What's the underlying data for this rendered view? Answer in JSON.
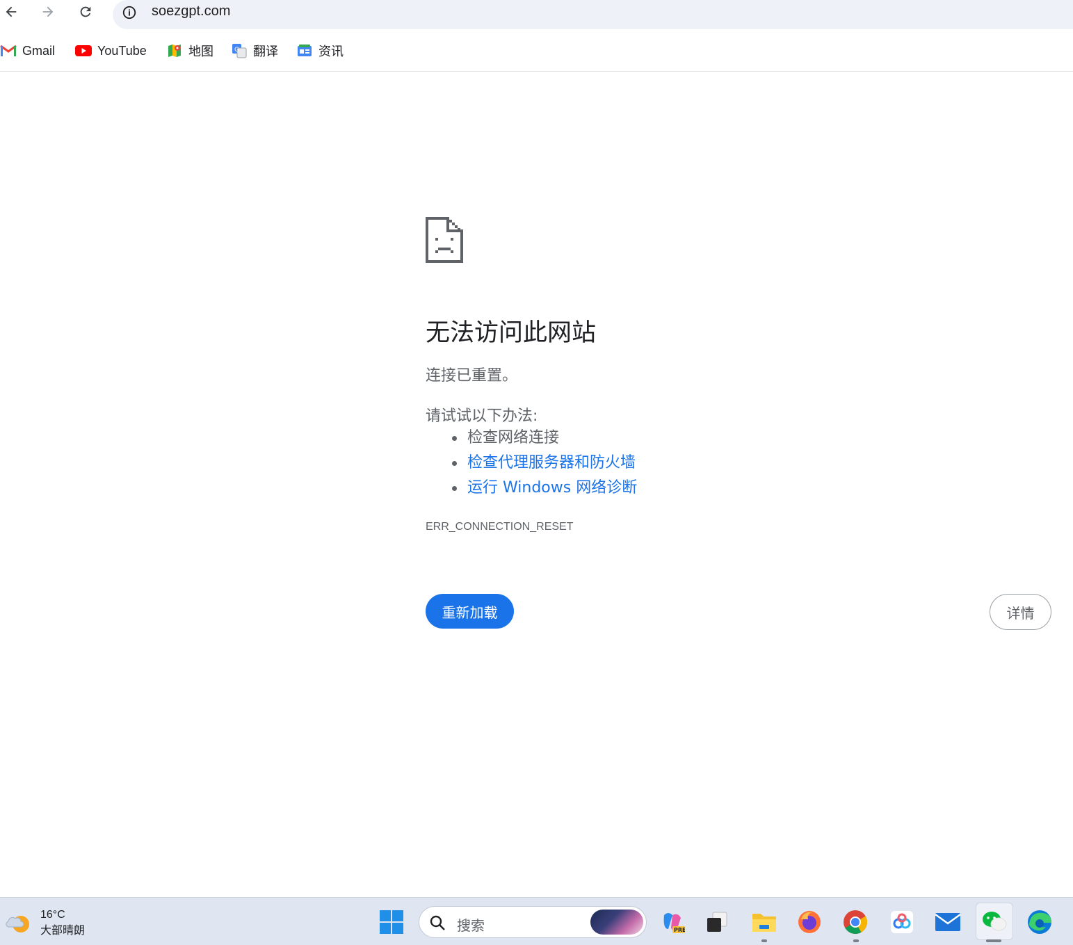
{
  "browser": {
    "url": "soezgpt.com",
    "bookmarks": [
      {
        "label": "Gmail",
        "icon": "gmail-icon"
      },
      {
        "label": "YouTube",
        "icon": "youtube-icon"
      },
      {
        "label": "地图",
        "icon": "maps-icon"
      },
      {
        "label": "翻译",
        "icon": "translate-icon"
      },
      {
        "label": "资讯",
        "icon": "news-icon"
      }
    ]
  },
  "error": {
    "icon": "sad-page-icon",
    "heading": "无法访问此网站",
    "subtitle": "连接已重置。",
    "suggest_title": "请试试以下办法:",
    "suggestions": [
      {
        "text": "检查网络连接",
        "link": false
      },
      {
        "text": "检查代理服务器和防火墙",
        "link": true
      },
      {
        "text": "运行 Windows 网络诊断",
        "link": true
      }
    ],
    "code": "ERR_CONNECTION_RESET",
    "reload_label": "重新加载",
    "details_label": "详情"
  },
  "taskbar": {
    "weather_temp": "16°C",
    "weather_desc": "大部晴朗",
    "search_placeholder": "搜索",
    "apps": [
      "start-icon",
      "copilot-icon",
      "task-view-icon",
      "file-explorer-icon",
      "firefox-icon",
      "chrome-icon",
      "baidu-netdisk-icon",
      "mail-icon",
      "wechat-icon",
      "edge-icon"
    ]
  },
  "colors": {
    "accent": "#1a73e8",
    "text_secondary": "#5f6368",
    "taskbar_bg": "#dfe6f1"
  }
}
